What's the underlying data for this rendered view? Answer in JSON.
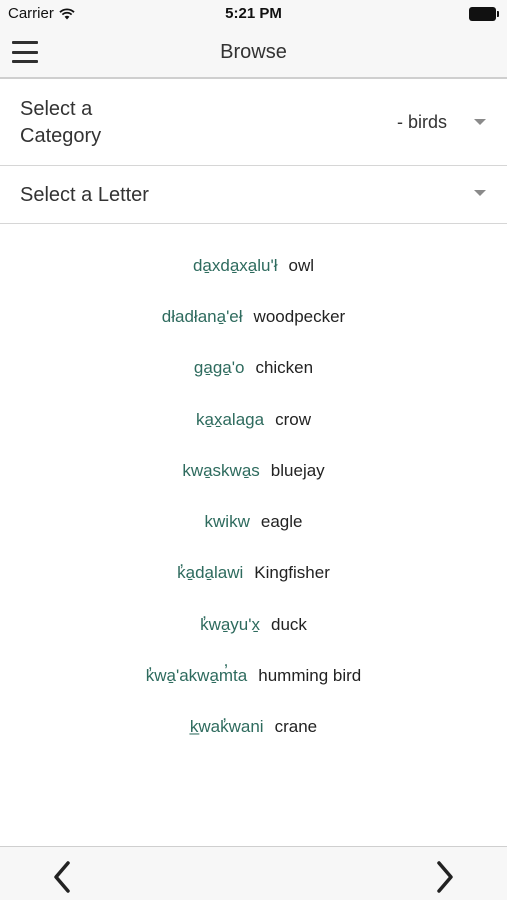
{
  "status_bar": {
    "carrier": "Carrier",
    "time": "5:21 PM",
    "wifi_icon": "wifi-icon",
    "battery_icon": "battery-icon"
  },
  "header": {
    "title": "Browse",
    "menu_icon": "hamburger-menu-icon"
  },
  "category_select": {
    "label": "Select a Category",
    "value": "- birds",
    "icon": "dropdown-caret-icon"
  },
  "letter_select": {
    "label": "Select a Letter",
    "value": "",
    "icon": "dropdown-caret-icon"
  },
  "words": [
    {
      "native": "da̱xda̱xa̱lu'ł",
      "english": "owl"
    },
    {
      "native": "dładłana̱'eł",
      "english": "woodpecker"
    },
    {
      "native": "ga̱ga̱'o",
      "english": "chicken"
    },
    {
      "native": "ka̱x̱alaga",
      "english": "crow"
    },
    {
      "native": "kwa̱skwa̱s",
      "english": "bluejay"
    },
    {
      "native": "kwikw",
      "english": "eagle"
    },
    {
      "native": "k̓a̱da̱lawi",
      "english": "Kingfisher"
    },
    {
      "native": "k̓wa̱yu'x̱",
      "english": "duck"
    },
    {
      "native": "k̓wa̱'akwa̱m̓ta",
      "english": "humming bird"
    },
    {
      "native": "k̲wak̓wani",
      "english": "crane"
    }
  ],
  "footer": {
    "prev_icon": "chevron-left-icon",
    "next_icon": "chevron-right-icon"
  },
  "colors": {
    "native_word": "#2e6b5e",
    "bar_background": "#f7f7f7",
    "divider": "#d6d6d6"
  }
}
